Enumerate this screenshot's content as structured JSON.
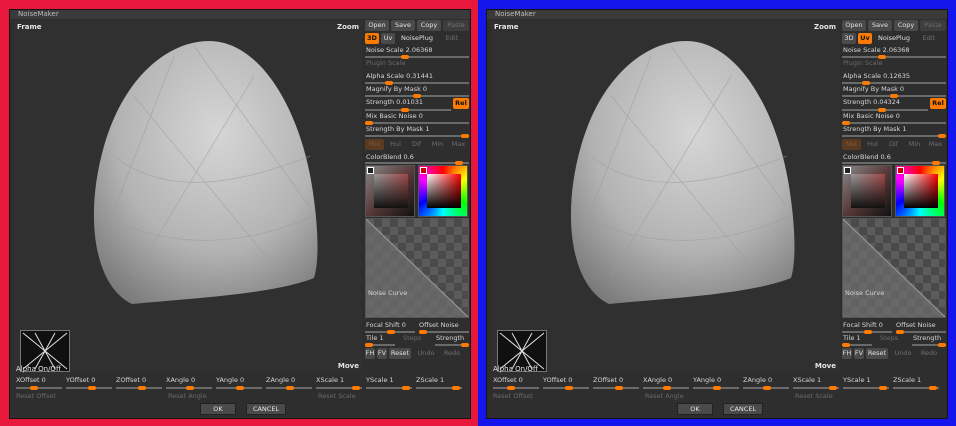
{
  "panels": [
    {
      "window_title": "NoiseMaker",
      "viewport": {
        "frame_label": "Frame",
        "zoom_label": "Zoom",
        "move_label": "Move",
        "alpha_label": "Alpha On/Off"
      },
      "toolbar": {
        "open": "Open",
        "save": "Save",
        "copy": "Copy",
        "paste": "Paste"
      },
      "mode_tabs": {
        "three_d": "3D",
        "uv": "Uv",
        "noiseplug": "NoisePlug",
        "edit": "Edit",
        "active": "3D"
      },
      "noise_scale": "Noise Scale 2.06368",
      "plugin_scale": "Plugin Scale",
      "alpha_scale": "Alpha Scale 0.31441",
      "magnify_by_mask": "Magnify By Mask 0",
      "strength": "Strength 0.01031",
      "rel": "Rel",
      "mix_basic_noise": "Mix Basic Noise 0",
      "strength_by_mask": "Strength By Mask 1",
      "blend_modes": [
        "Mix",
        "Hul",
        "Dif",
        "Min",
        "Max"
      ],
      "color_blend": "ColorBlend 0.6",
      "noise_curve": "Noise Curve",
      "focal_shift": "Focal Shift 0",
      "offset_noise": "Offset Noise",
      "tile": "Tile 1",
      "steps": "Steps",
      "strength2": "Strength",
      "fh": "FH",
      "fv": "FV",
      "reset": "Reset",
      "undo": "Undo",
      "redo": "Redo",
      "bottom_sliders": [
        "XOffset 0",
        "YOffset 0",
        "ZOffset 0",
        "XAngle 0",
        "YAngle 0",
        "ZAngle 0",
        "XScale 1",
        "YScale 1",
        "ZScale 1"
      ],
      "reset_offset": "Reset Offset",
      "reset_angle": "Reset Angle",
      "reset_scale": "Reset Scale",
      "ok": "OK",
      "cancel": "CANCEL",
      "frame_color": "#e8173c"
    },
    {
      "window_title": "NoiseMaker",
      "viewport": {
        "frame_label": "Frame",
        "zoom_label": "Zoom",
        "move_label": "Move",
        "alpha_label": "Alpha On/Off"
      },
      "toolbar": {
        "open": "Open",
        "save": "Save",
        "copy": "Copy",
        "paste": "Paste"
      },
      "mode_tabs": {
        "three_d": "3D",
        "uv": "Uv",
        "noiseplug": "NoisePlug",
        "edit": "Edit",
        "active": "Uv"
      },
      "noise_scale": "Noise Scale 2.06368",
      "plugin_scale": "Plugin Scale",
      "alpha_scale": "Alpha Scale 0.12635",
      "magnify_by_mask": "Magnify By Mask 0",
      "strength": "Strength 0.04324",
      "rel": "Rel",
      "mix_basic_noise": "Mix Basic Noise 0",
      "strength_by_mask": "Strength By Mask 1",
      "blend_modes": [
        "Mix",
        "Hul",
        "Dif",
        "Min",
        "Max"
      ],
      "color_blend": "ColorBlend 0.6",
      "noise_curve": "Noise Curve",
      "focal_shift": "Focal Shift 0",
      "offset_noise": "Offset Noise",
      "tile": "Tile 1",
      "steps": "Steps",
      "strength2": "Strength",
      "fh": "FH",
      "fv": "FV",
      "reset": "Reset",
      "undo": "Undo",
      "redo": "Redo",
      "bottom_sliders": [
        "XOffset 0",
        "YOffset 0",
        "ZOffset 0",
        "XAngle 0",
        "YAngle 0",
        "ZAngle 0",
        "XScale 1",
        "YScale 1",
        "ZScale 1"
      ],
      "reset_offset": "Reset Offset",
      "reset_angle": "Reset Angle",
      "reset_scale": "Reset Scale",
      "ok": "OK",
      "cancel": "CANCEL",
      "frame_color": "#1515ee"
    }
  ]
}
